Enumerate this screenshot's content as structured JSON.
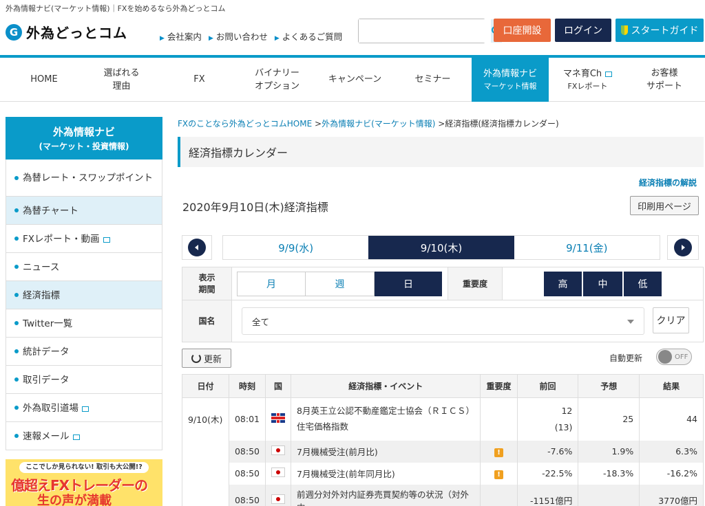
{
  "header": {
    "tagline": "外為情報ナビ(マーケット情報)｜FXを始めるなら外為どっとコム",
    "logo_mark": "G",
    "logo_text": "外為どっとコム",
    "links": [
      "会社案内",
      "お問い合わせ",
      "よくあるご質問"
    ],
    "search_placeholder": "",
    "open_account": "口座開設",
    "login": "ログイン",
    "start_guide": "スタートガイド"
  },
  "nav": [
    {
      "l1": "HOME",
      "l2": ""
    },
    {
      "l1": "選ばれる",
      "l2": "理由"
    },
    {
      "l1": "FX",
      "l2": ""
    },
    {
      "l1": "バイナリー",
      "l2": "オプション"
    },
    {
      "l1": "キャンペーン",
      "l2": ""
    },
    {
      "l1": "セミナー",
      "l2": ""
    },
    {
      "l1": "外為情報ナビ",
      "l2": "マーケット情報"
    },
    {
      "l1": "マネ育Ch",
      "l2": "FXレポート"
    },
    {
      "l1": "お客様",
      "l2": "サポート"
    }
  ],
  "sidebar": {
    "title": "外為情報ナビ",
    "subtitle": "(マーケット・投資情報)",
    "items": [
      "為替レート・スワップポイント",
      "為替チャート",
      "FXレポート・動画",
      "ニュース",
      "経済指標",
      "Twitter一覧",
      "統計データ",
      "取引データ",
      "外為取引道場",
      "速報メール"
    ],
    "banner_top": "ここでしか見られない! 取引も大公開!?",
    "banner_main": "億超えFXトレーダーの",
    "banner_sub": "生の声が満載"
  },
  "breadcrumb": {
    "home": "FXのことなら外為どっとコムHOME",
    "sep1": ">",
    "parent": "外為情報ナビ(マーケット情報)",
    "sep2": ">",
    "current": "経済指標(経済指標カレンダー)"
  },
  "page": {
    "title": "経済指標カレンダー",
    "explain_link": "経済指標の解説",
    "date_title": "2020年9月10日(木)経済指標",
    "print": "印刷用ページ"
  },
  "days": [
    "9/9(水)",
    "9/10(木)",
    "9/11(金)"
  ],
  "filter": {
    "period_label1": "表示",
    "period_label2": "期間",
    "periods": [
      "月",
      "週",
      "日"
    ],
    "importance_label": "重要度",
    "importance": [
      "高",
      "中",
      "低"
    ],
    "country_label": "国名",
    "country_value": "全て",
    "clear": "クリア"
  },
  "controls": {
    "refresh": "更新",
    "auto_refresh": "自動更新",
    "toggle": "OFF"
  },
  "table": {
    "headers": [
      "日付",
      "時刻",
      "国",
      "経済指標・イベント",
      "重要度",
      "前回",
      "予想",
      "結果"
    ],
    "rows": [
      {
        "date": "9/10(木)",
        "time": "08:01",
        "flag": "uk",
        "event": "8月英王立公認不動産鑑定士協会（ＲＩＣＳ）住宅価格指数",
        "imp": "",
        "prev": "12",
        "prev2": "(13)",
        "fcst": "25",
        "res": "44"
      },
      {
        "date": "",
        "time": "08:50",
        "flag": "jp",
        "event": "7月機械受注(前月比)",
        "imp": "!",
        "prev": "-7.6%",
        "prev2": "",
        "fcst": "1.9%",
        "res": "6.3%"
      },
      {
        "date": "",
        "time": "08:50",
        "flag": "jp",
        "event": "7月機械受注(前年同月比)",
        "imp": "!",
        "prev": "-22.5%",
        "prev2": "",
        "fcst": "-18.3%",
        "res": "-16.2%"
      },
      {
        "date": "",
        "time": "08:50",
        "flag": "jp",
        "event": "前週分対外対内証券売買契約等の状況（対外中",
        "imp": "",
        "prev": "-1151億円",
        "prev2": "",
        "fcst": "",
        "res": "3770億円"
      }
    ]
  }
}
